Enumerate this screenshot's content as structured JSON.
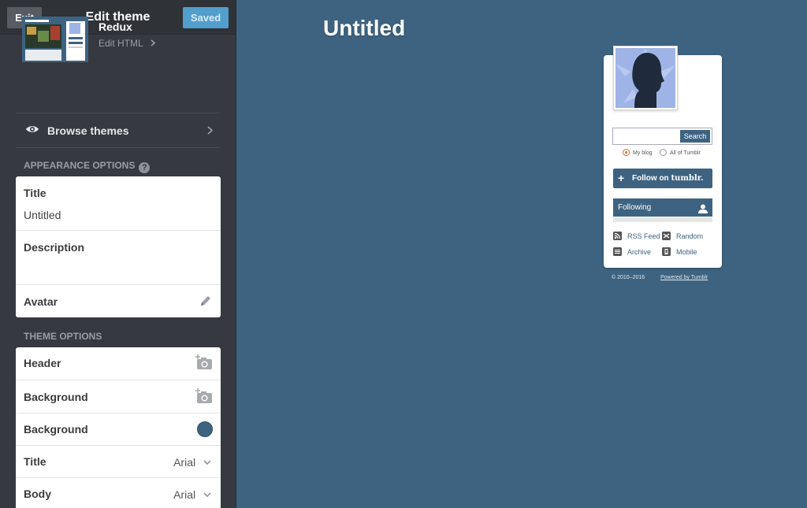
{
  "topbar": {
    "exit_label": "Exit",
    "title": "Edit theme",
    "saved_label": "Saved"
  },
  "theme": {
    "name": "Redux",
    "edit_html_label": "Edit HTML"
  },
  "browse": {
    "label": "Browse themes"
  },
  "appearance": {
    "heading": "APPEARANCE OPTIONS",
    "title_label": "Title",
    "title_value": "Untitled",
    "description_label": "Description",
    "description_value": "",
    "avatar_label": "Avatar"
  },
  "theme_options": {
    "heading": "THEME OPTIONS",
    "header_label": "Header",
    "background_image_label": "Background",
    "background_color_label": "Background",
    "background_color": "#3d6381",
    "title_font_label": "Title",
    "title_font_value": "Arial",
    "body_font_label": "Body",
    "body_font_value": "Arial"
  },
  "preview": {
    "blog_title": "Untitled",
    "search_button": "Search",
    "search_placeholder": "",
    "radio_my_blog": "My blog",
    "radio_all": "All of Tumblr",
    "follow_text": "Follow on",
    "follow_brand": "tumblr.",
    "following_label": "Following",
    "links": {
      "rss": "RSS Feed",
      "random": "Random",
      "archive": "Archive",
      "mobile": "Mobile"
    },
    "footer_copyright": "© 2010–2016",
    "footer_powered": "Powered by Tumblr"
  },
  "colors": {
    "accent": "#529ecc",
    "preview_background": "#3d6381",
    "sidebar": "#36393f"
  }
}
